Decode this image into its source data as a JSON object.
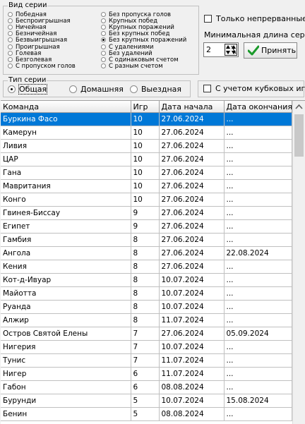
{
  "series_kind": {
    "title": "Вид серии",
    "left": [
      {
        "label": "Победная",
        "selected": false
      },
      {
        "label": "Беспроигрышная",
        "selected": false
      },
      {
        "label": "Ничейная",
        "selected": false
      },
      {
        "label": "Безничейная",
        "selected": false
      },
      {
        "label": "Безвыигрышная",
        "selected": false
      },
      {
        "label": "Проигрышная",
        "selected": false
      },
      {
        "label": "Голевая",
        "selected": false
      },
      {
        "label": "Безголевая",
        "selected": false
      },
      {
        "label": "С пропуском голов",
        "selected": false
      }
    ],
    "right": [
      {
        "label": "Без пропуска голов",
        "selected": false
      },
      {
        "label": "Крупных побед",
        "selected": false
      },
      {
        "label": "Крупных поражений",
        "selected": false
      },
      {
        "label": "Без крупных побед",
        "selected": false
      },
      {
        "label": "Без крупных поражений",
        "selected": true
      },
      {
        "label": "С удалениями",
        "selected": false
      },
      {
        "label": "Без удалений",
        "selected": false
      },
      {
        "label": "С одинаковым счетом",
        "selected": false
      },
      {
        "label": "С разным счетом",
        "selected": false
      }
    ]
  },
  "options": {
    "continuous_label": "Только непрерванные",
    "continuous_checked": false,
    "min_length_label": "Минимальная длина серии",
    "min_length_value": "2",
    "apply_label": "Принять",
    "cup_games_label": "С учетом кубковых игр",
    "cup_games_checked": false
  },
  "series_type": {
    "title": "Тип серии",
    "items": [
      {
        "label": "Общая",
        "selected": true
      },
      {
        "label": "Домашняя",
        "selected": false
      },
      {
        "label": "Выездная",
        "selected": false
      }
    ]
  },
  "table": {
    "columns": [
      "Команда",
      "Игр",
      "Дата начала",
      "Дата окончания"
    ],
    "selected_index": 0,
    "rows": [
      [
        "Буркина Фасо",
        "10",
        "27.06.2024",
        "..."
      ],
      [
        "Камерун",
        "10",
        "27.06.2024",
        "..."
      ],
      [
        "Ливия",
        "10",
        "27.06.2024",
        "..."
      ],
      [
        "ЦАР",
        "10",
        "27.06.2024",
        "..."
      ],
      [
        "Гана",
        "10",
        "27.06.2024",
        "..."
      ],
      [
        "Мавритания",
        "10",
        "27.06.2024",
        "..."
      ],
      [
        "Конго",
        "10",
        "27.06.2024",
        "..."
      ],
      [
        "Гвинея-Биссау",
        "9",
        "27.06.2024",
        "..."
      ],
      [
        "Египет",
        "9",
        "27.06.2024",
        "..."
      ],
      [
        "Гамбия",
        "8",
        "27.06.2024",
        "..."
      ],
      [
        "Ангола",
        "8",
        "27.06.2024",
        "22.08.2024"
      ],
      [
        "Кения",
        "8",
        "27.06.2024",
        "..."
      ],
      [
        "Кот-д-Ивуар",
        "8",
        "10.07.2024",
        "..."
      ],
      [
        "Майотта",
        "8",
        "10.07.2024",
        "..."
      ],
      [
        "Руанда",
        "8",
        "10.07.2024",
        "..."
      ],
      [
        "Алжир",
        "8",
        "11.07.2024",
        "..."
      ],
      [
        "Остров Святой Елены",
        "7",
        "27.06.2024",
        "05.09.2024"
      ],
      [
        "Нигерия",
        "7",
        "10.07.2024",
        "..."
      ],
      [
        "Тунис",
        "7",
        "11.07.2024",
        "..."
      ],
      [
        "Нигер",
        "6",
        "11.07.2024",
        "..."
      ],
      [
        "Габон",
        "6",
        "08.08.2024",
        "..."
      ],
      [
        "Бурунди",
        "5",
        "10.07.2024",
        "15.08.2024"
      ],
      [
        "Бенин",
        "5",
        "08.08.2024",
        "..."
      ]
    ]
  }
}
